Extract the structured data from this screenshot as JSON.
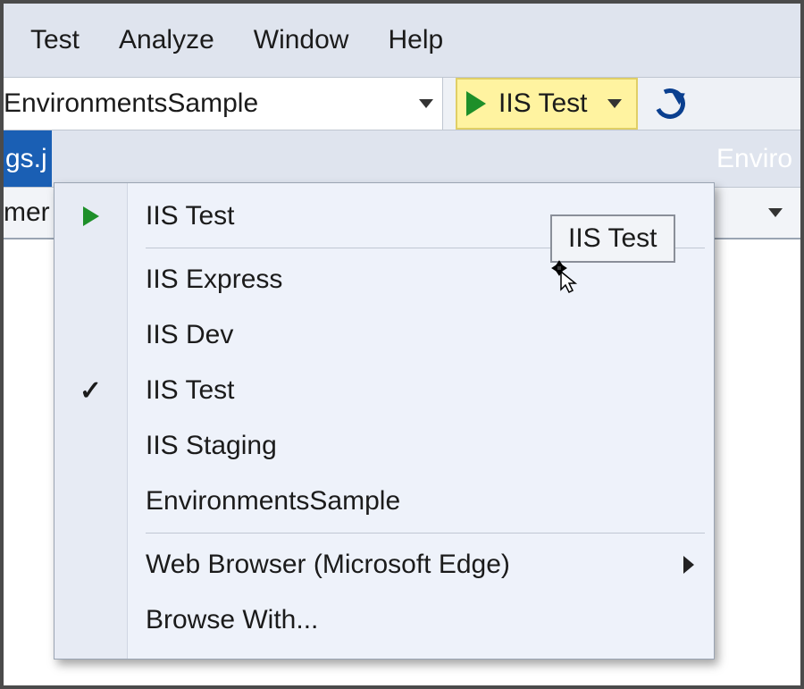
{
  "menubar": {
    "items": [
      "Test",
      "Analyze",
      "Window",
      "Help"
    ]
  },
  "toolbar": {
    "project_combo": {
      "selected": "EnvironmentsSample"
    },
    "run_button": {
      "label": "IIS Test"
    }
  },
  "tabstrip": {
    "left_fragment": "gs.j",
    "right_fragment": "Enviro"
  },
  "navrow": {
    "left_fragment": "mer"
  },
  "run_dropdown": {
    "top": {
      "label": "IIS Test"
    },
    "profiles": [
      {
        "label": "IIS Express",
        "checked": false
      },
      {
        "label": "IIS Dev",
        "checked": false
      },
      {
        "label": "IIS Test",
        "checked": true
      },
      {
        "label": "IIS Staging",
        "checked": false
      },
      {
        "label": "EnvironmentsSample",
        "checked": false
      }
    ],
    "web_browser": {
      "label": "Web Browser (Microsoft Edge)"
    },
    "browse_with": {
      "label": "Browse With..."
    }
  },
  "tooltip": {
    "text": "IIS Test"
  }
}
